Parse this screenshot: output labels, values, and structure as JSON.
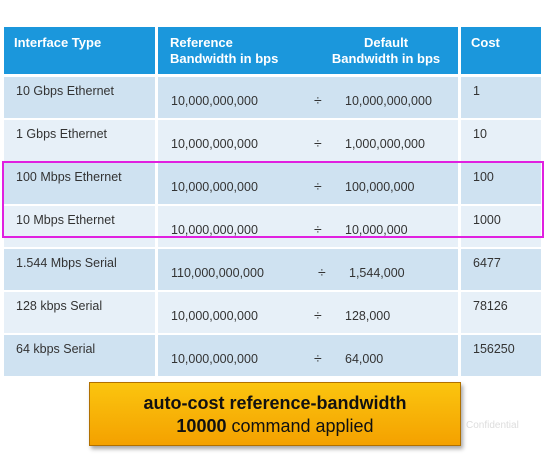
{
  "header": {
    "interface_type": "Interface Type",
    "reference_line1": "Reference",
    "reference_line2": "Bandwidth in bps",
    "default_line1": "Default",
    "default_line2": "Bandwidth in bps",
    "cost": "Cost"
  },
  "rows": [
    {
      "interface": "10 Gbps Ethernet",
      "reference": "10,000,000,000",
      "op": "÷",
      "default": "10,000,000,000",
      "cost": "1"
    },
    {
      "interface": "1 Gbps Ethernet",
      "reference": "10,000,000,000",
      "op": "÷",
      "default": "1,000,000,000",
      "cost": "10"
    },
    {
      "interface": "100 Mbps Ethernet",
      "reference": "10,000,000,000",
      "op": "÷",
      "default": "100,000,000",
      "cost": "100"
    },
    {
      "interface": "10 Mbps Ethernet",
      "reference": "10,000,000,000",
      "op": "÷",
      "default": "10,000,000",
      "cost": "1000"
    },
    {
      "interface": "1.544 Mbps Serial",
      "reference": "110,000,000,000",
      "op": "÷",
      "default": "1,544,000",
      "cost": "6477"
    },
    {
      "interface": "128 kbps Serial",
      "reference": "10,000,000,000",
      "op": "÷",
      "default": "128,000",
      "cost": "78126"
    },
    {
      "interface": "64 kbps Serial",
      "reference": "10,000,000,000",
      "op": "÷",
      "default": "64,000",
      "cost": "156250"
    }
  ],
  "banner": {
    "line1": "auto-cost reference-bandwidth",
    "line2_bold": "10000",
    "line2_rest": " command applied"
  },
  "watermark": "Confidential",
  "colors": {
    "header_bg": "#1b97dc",
    "row_dark": "#cfe2f1",
    "row_light": "#e7f0f8",
    "highlight_border": "#e020e0",
    "banner_bg": "#f4a100"
  }
}
